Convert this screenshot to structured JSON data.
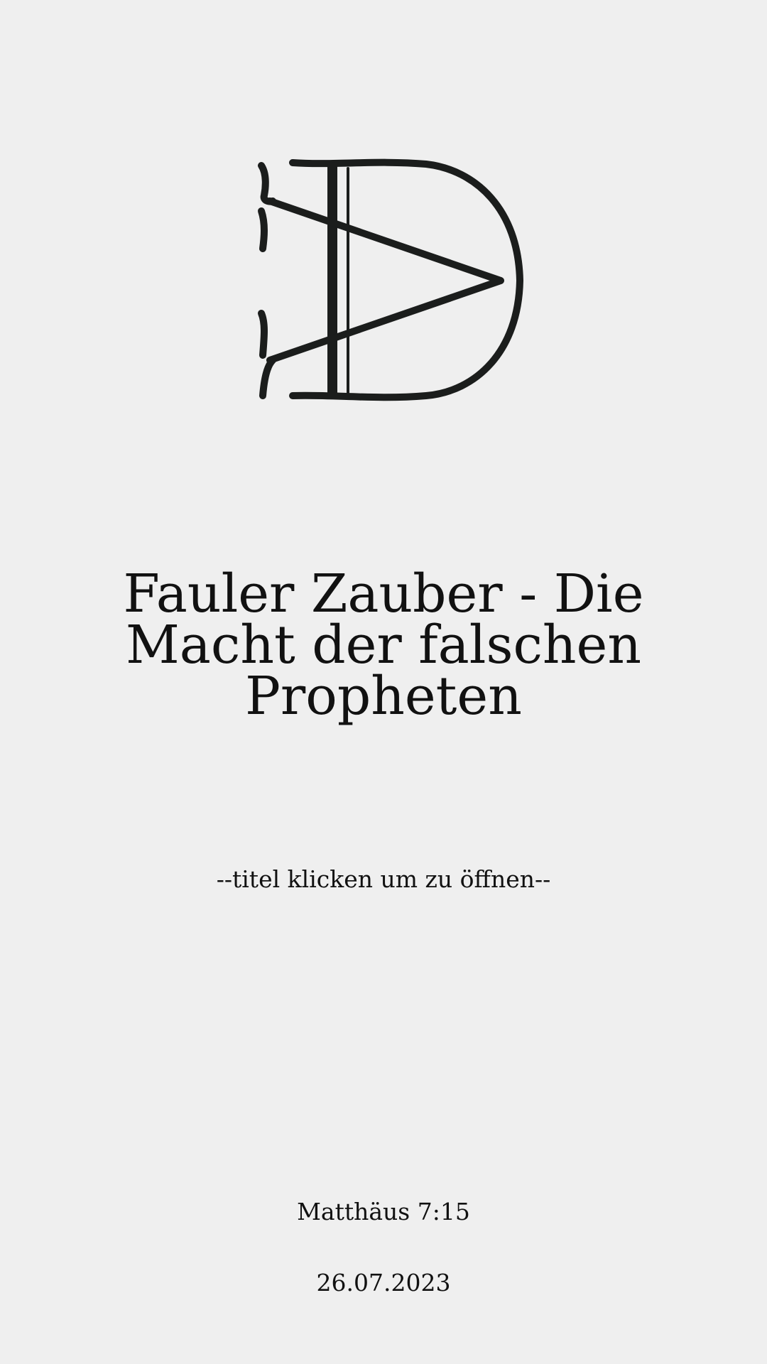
{
  "page": {
    "background": "#efefef",
    "text_color": "#111111"
  },
  "logo": {
    "icon": "dv-monogram-icon",
    "color": "#1b1d1c"
  },
  "title": {
    "text": "Fauler Zauber - Die Macht der falschen Propheten"
  },
  "hint": {
    "text": "--titel klicken um zu öffnen--"
  },
  "footer": {
    "verse": "Matthäus 7:15",
    "date": "26.07.2023"
  }
}
